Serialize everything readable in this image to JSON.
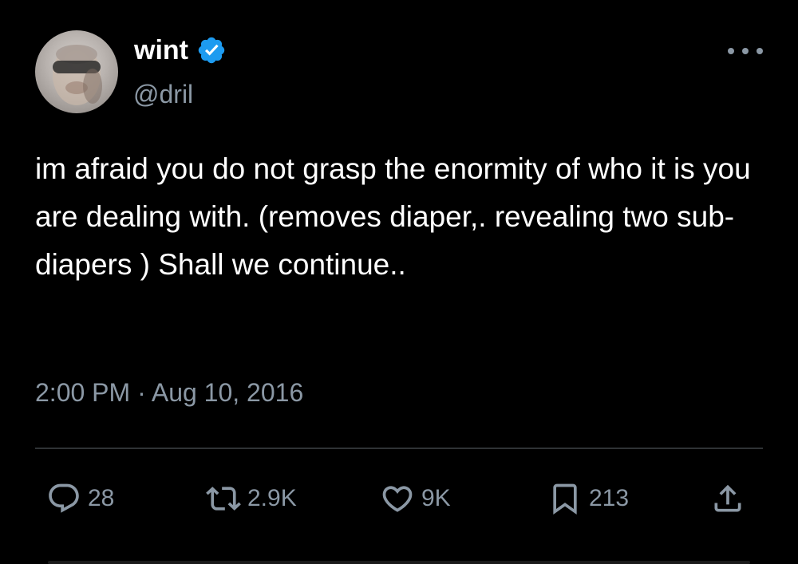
{
  "author": {
    "display_name": "wint",
    "handle": "@dril",
    "verified": true,
    "verified_color": "#1d9bf0"
  },
  "tweet": {
    "text": "im afraid you do not grasp the enormity of who it is you are dealing with. (removes diaper,. revealing two sub-diapers ) Shall we continue..",
    "timestamp": "2:00 PM · Aug 10, 2016"
  },
  "actions": {
    "reply": {
      "icon": "reply-icon",
      "count": "28"
    },
    "retweet": {
      "icon": "retweet-icon",
      "count": "2.9K"
    },
    "like": {
      "icon": "heart-icon",
      "count": "9K"
    },
    "bookmark": {
      "icon": "bookmark-icon",
      "count": "213"
    },
    "share": {
      "icon": "share-icon"
    }
  },
  "colors": {
    "background": "#000000",
    "primary_text": "#ffffff",
    "secondary_text": "#8b98a5",
    "divider": "#2f3336"
  }
}
